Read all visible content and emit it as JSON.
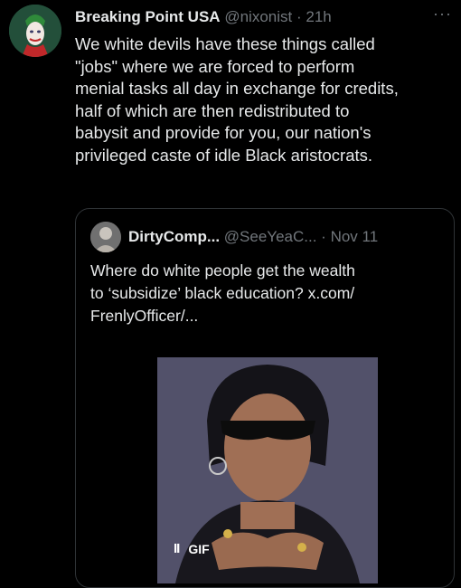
{
  "tweet": {
    "author_name": "Breaking Point USA",
    "handle": "@nixonist",
    "separator": "·",
    "time": "21h",
    "more": "···",
    "text": "We white devils have these things called\n\"jobs\" where we are forced to perform\nmenial tasks all day in exchange for credits,\nhalf of which are then redistributed to\nbabysit and provide for you, our nation's\nprivileged caste of idle Black aristocrats.",
    "avatar_icon": "joker-avatar"
  },
  "quote": {
    "author_name": "DirtyComp...",
    "handle": "@SeeYeaC...",
    "separator": "·",
    "date": "Nov 11",
    "text": "Where do white people get the wealth\nto ‘subsidize’ black education?  x.com/\nFrenlyOfficer/...",
    "avatar_icon": "user-avatar",
    "media": {
      "gif_badge": "GIF",
      "pause_icon": "II"
    }
  },
  "colors": {
    "background": "#000000",
    "text_primary": "#e7e9ea",
    "text_secondary": "#71767b",
    "border": "#2f3336"
  }
}
